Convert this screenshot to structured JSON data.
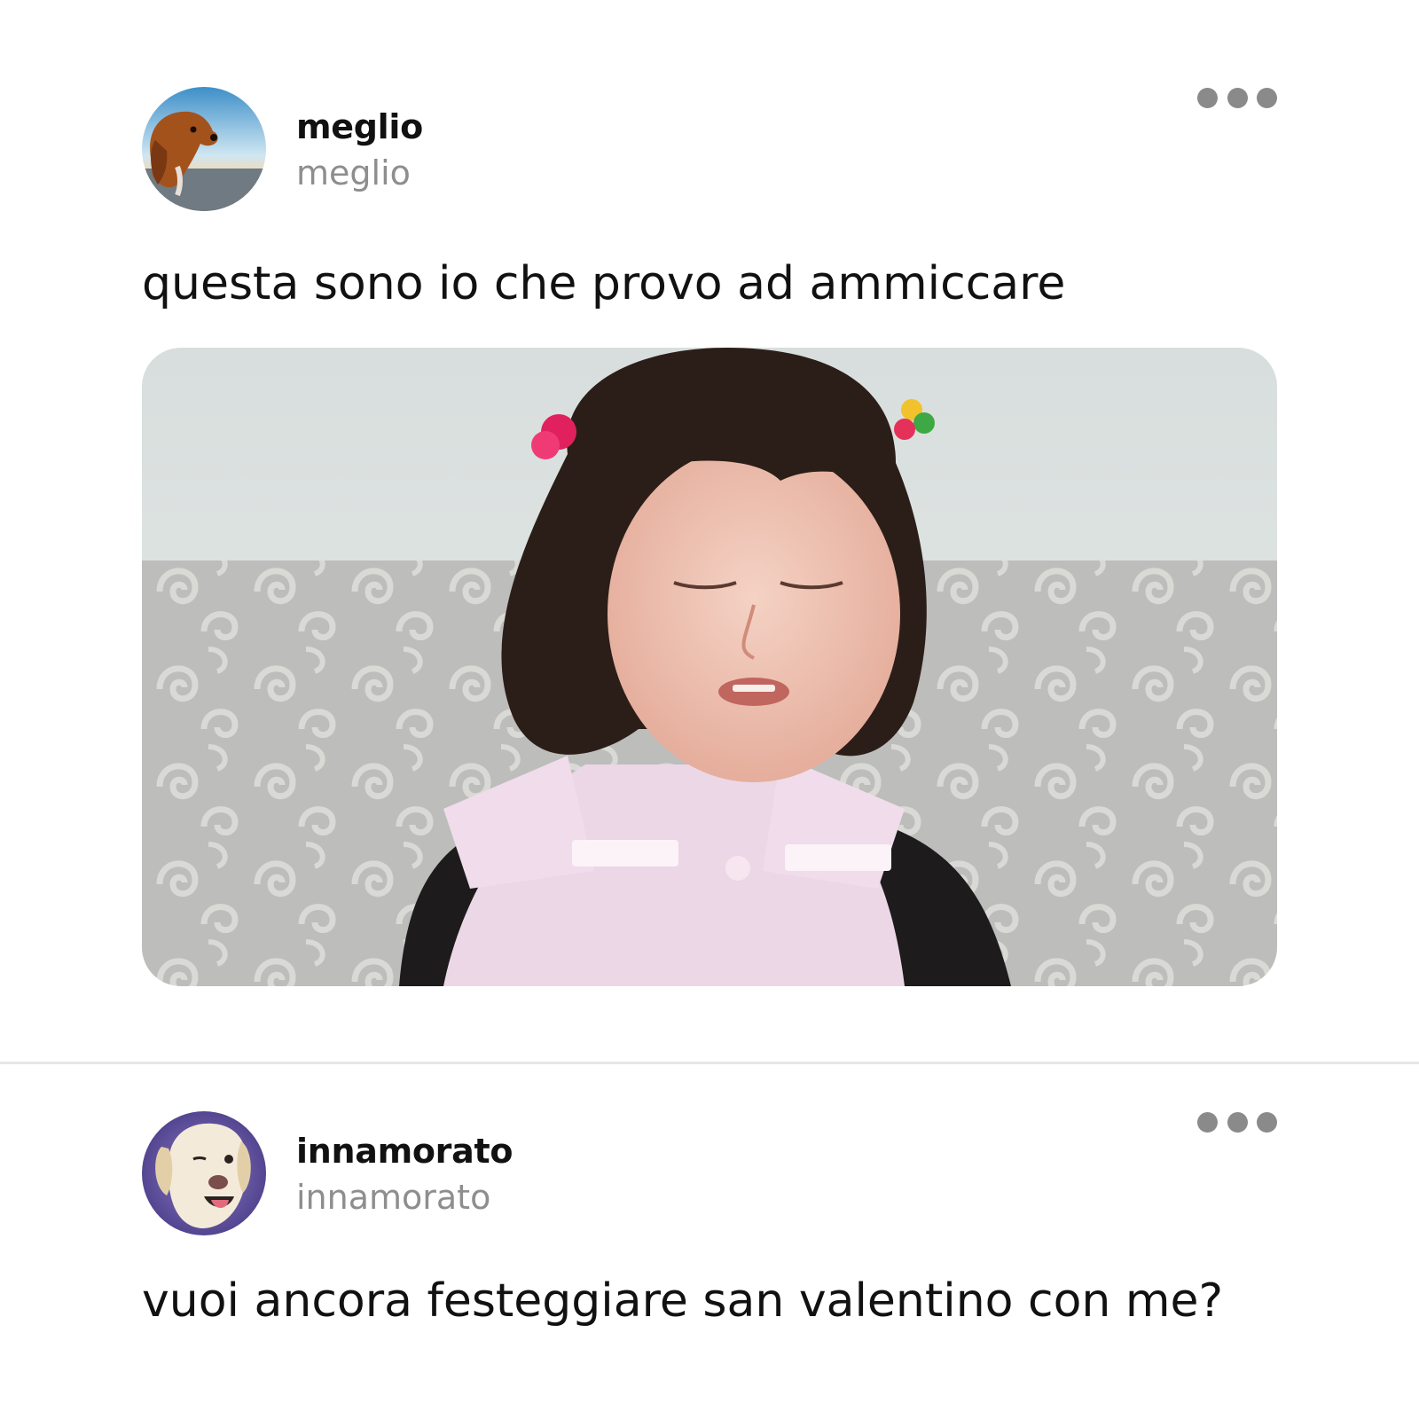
{
  "feed": {
    "posts": [
      {
        "display_name": "meglio",
        "handle": "meglio",
        "avatar_icon": "dog-avatar-icon",
        "text": "questa sono io che provo ad ammiccare",
        "has_image": true
      },
      {
        "display_name": "innamorato",
        "handle": "innamorato",
        "avatar_icon": "dog-avatar-icon",
        "text": "vuoi ancora festeggiare san valentino con me?",
        "has_image": false
      }
    ]
  },
  "colors": {
    "text": "#111111",
    "handle": "#8e8e8e",
    "menu_dots": "#8a8a8a",
    "divider": "#e6e6e6"
  }
}
